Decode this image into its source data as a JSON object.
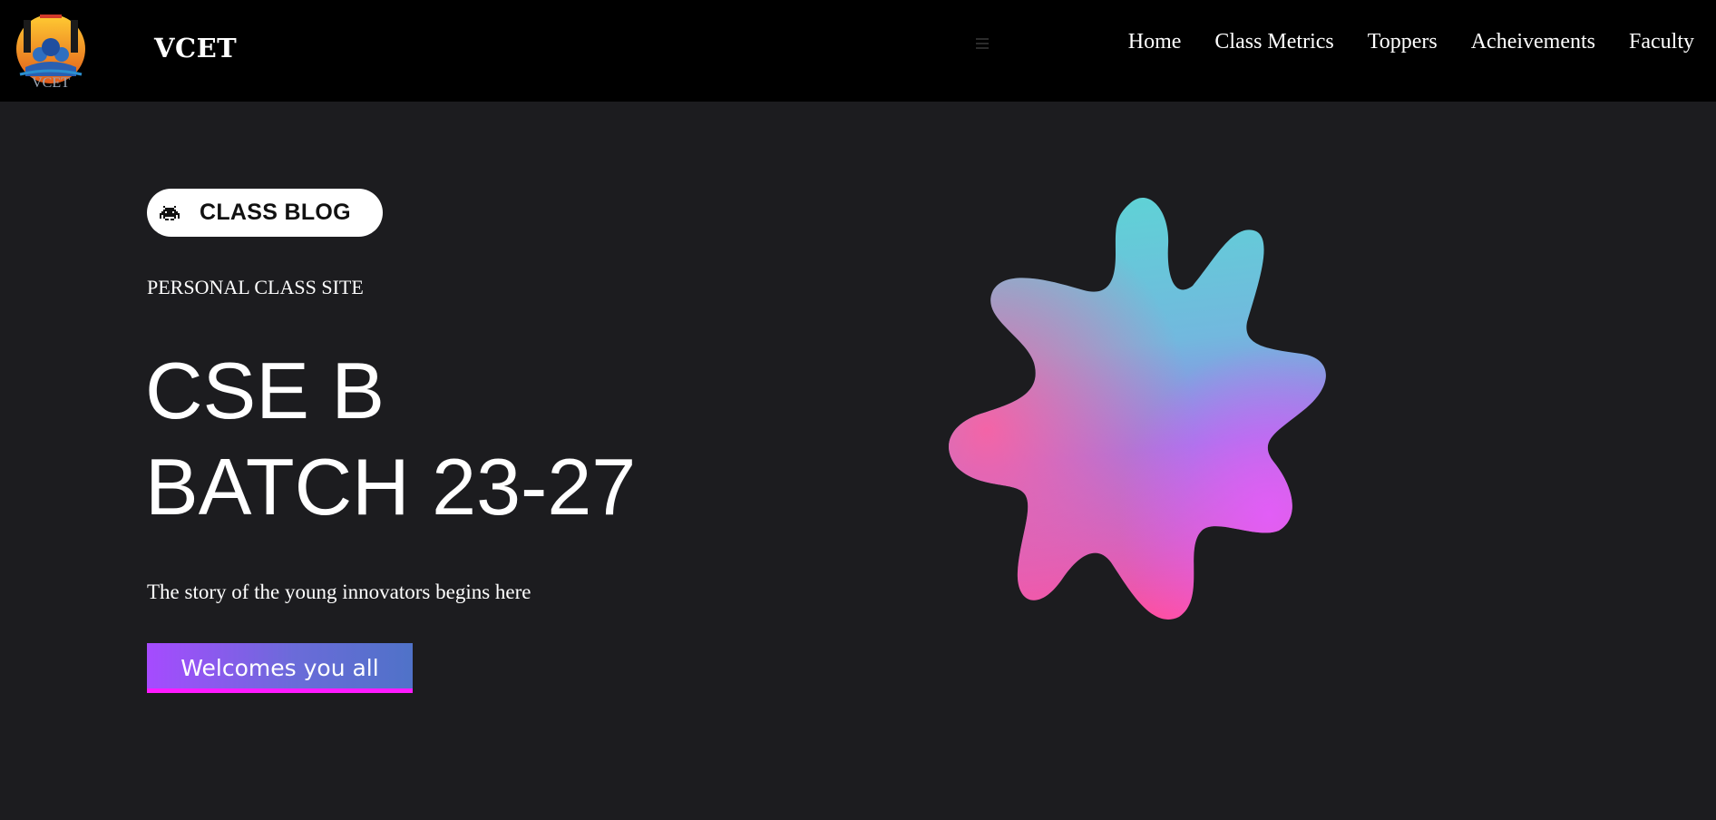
{
  "navbar": {
    "brand": "VCET",
    "logo_text": "VCET",
    "menu_icon": "hamburger-menu-icon",
    "links": [
      "Home",
      "Class Metrics",
      "Toppers",
      "Acheivements",
      "Faculty"
    ]
  },
  "hero": {
    "pill_icon": "space-invader-icon",
    "pill_label": "CLASS BLOG",
    "subtitle": "PERSONAL CLASS SITE",
    "headline_line1": "CSE B",
    "headline_line2": "BATCH 23-27",
    "tagline": "The story of the young innovators begins here",
    "cta_label": "Welcomes you all"
  },
  "colors": {
    "nav_bg": "#000000",
    "page_bg": "#1c1c1f",
    "cta_start": "#a64bff",
    "cta_end": "#4f72c8",
    "blob_top": "#5fd2d6",
    "blob_mid": "#9b7be6",
    "blob_bottom": "#ff4fa0"
  }
}
